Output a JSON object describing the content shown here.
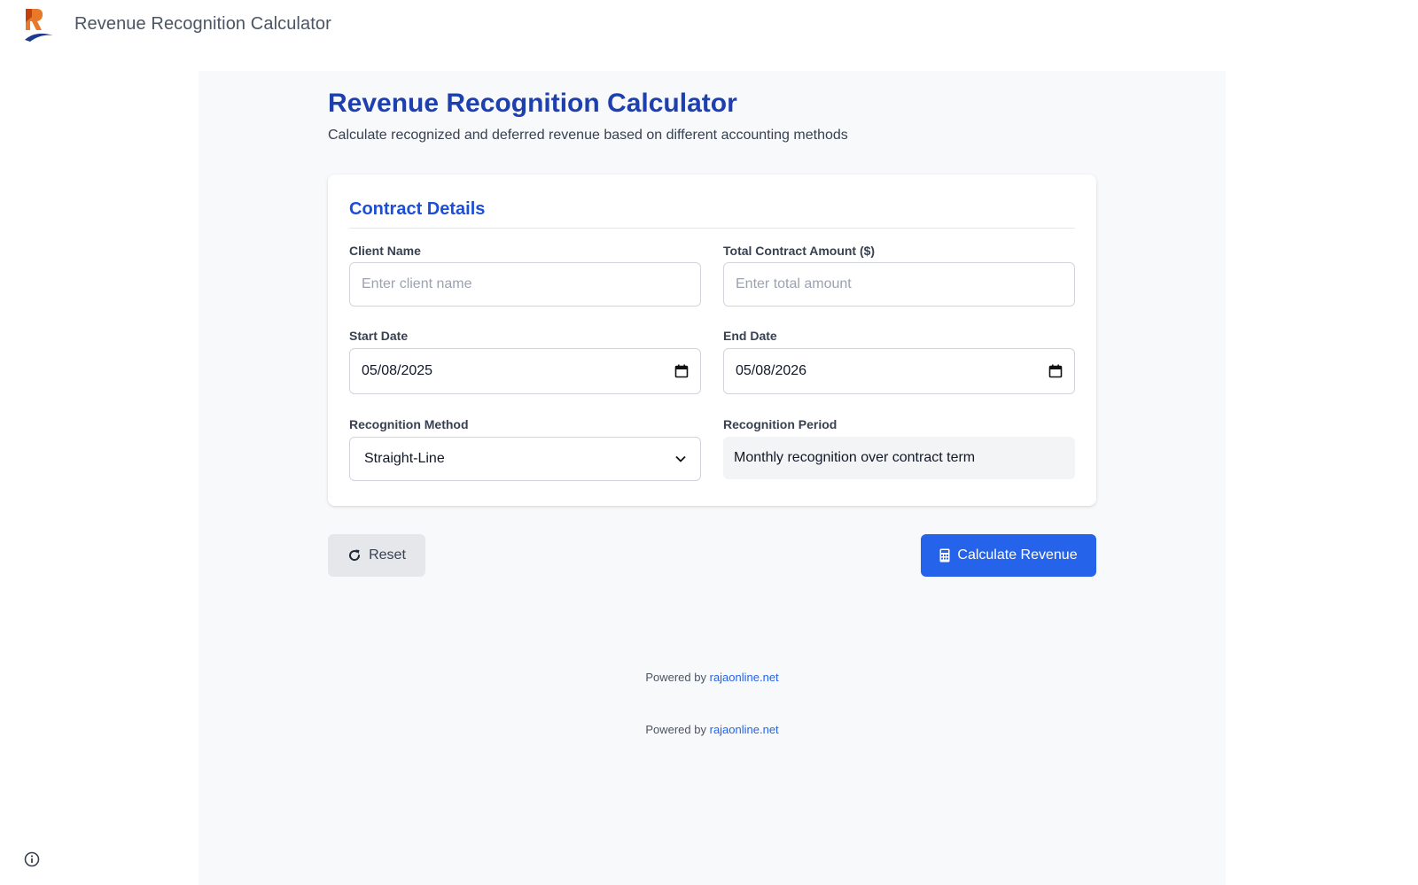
{
  "header": {
    "app_title": "Revenue Recognition Calculator",
    "logo_icon": "brand-logo"
  },
  "main": {
    "title": "Revenue Recognition Calculator",
    "subtitle": "Calculate recognized and deferred revenue based on different accounting methods"
  },
  "contract": {
    "section_title": "Contract Details",
    "client_name": {
      "label": "Client Name",
      "placeholder": "Enter client name",
      "value": ""
    },
    "total_amount": {
      "label": "Total Contract Amount ($)",
      "placeholder": "Enter total amount",
      "value": ""
    },
    "start_date": {
      "label": "Start Date",
      "value": "05/08/2025",
      "icon": "calendar-icon"
    },
    "end_date": {
      "label": "End Date",
      "value": "05/08/2026",
      "icon": "calendar-icon"
    },
    "method": {
      "label": "Recognition Method",
      "value": "Straight-Line"
    },
    "period": {
      "label": "Recognition Period",
      "value": "Monthly recognition over contract term"
    }
  },
  "actions": {
    "reset_label": "Reset",
    "reset_icon": "rotate-cw-icon",
    "calculate_label": "Calculate Revenue",
    "calculate_icon": "calculator-icon"
  },
  "footer": {
    "powered_prefix": "Powered by",
    "powered_link": "rajaonline.net",
    "info_icon": "info-icon"
  },
  "colors": {
    "primary": "#2563eb",
    "title": "#1e40af",
    "panel_bg": "#f8f9fb"
  }
}
